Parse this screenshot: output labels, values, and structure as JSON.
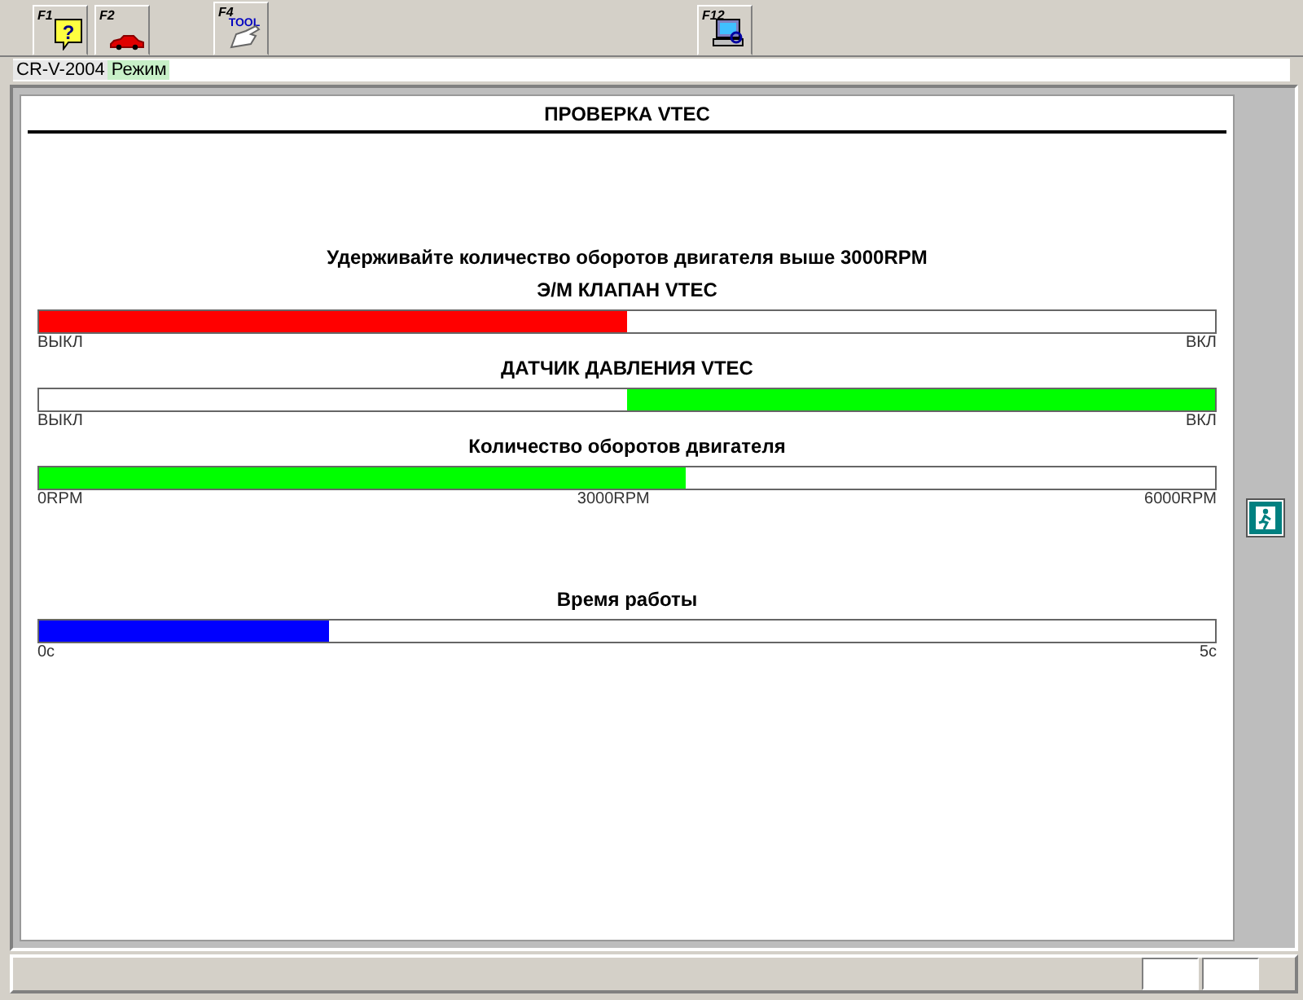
{
  "toolbar": {
    "tabs": [
      {
        "key": "F1",
        "kind": "help",
        "icon_text": "?",
        "selected": false
      },
      {
        "key": "F2",
        "kind": "car",
        "selected": false
      },
      {
        "key": "F4",
        "kind": "tool",
        "icon_text": "TOOL",
        "selected": true
      },
      {
        "key": "F12",
        "kind": "computer",
        "selected": false
      }
    ]
  },
  "breadcrumb": {
    "vehicle": "CR-V-2004",
    "mode": "Режим"
  },
  "panel": {
    "title": "ПРОВЕРКА VTEC",
    "instruction": "Удерживайте количество оборотов двигателя выше 3000RPM",
    "gauges": [
      {
        "kind": "switch",
        "label": "Э/М КЛАПАН VTEC",
        "on": false,
        "color": "#ff0000",
        "scale": [
          "ВЫКЛ",
          "ВКЛ"
        ]
      },
      {
        "kind": "switch",
        "label": "ДАТЧИК ДАВЛЕНИЯ VTEC",
        "on": true,
        "color": "#00ff00",
        "scale": [
          "ВЫКЛ",
          "ВКЛ"
        ]
      },
      {
        "kind": "meter",
        "label": "Количество оборотов двигателя",
        "level": 0.55,
        "color": "#00ff00",
        "scale": [
          "0RPM",
          "3000RPM",
          "6000RPM"
        ]
      },
      {
        "kind": "meter",
        "label": "Время работы",
        "level": 0.246,
        "color": "#0000ff",
        "scale": [
          "0с",
          "5с"
        ]
      }
    ]
  }
}
